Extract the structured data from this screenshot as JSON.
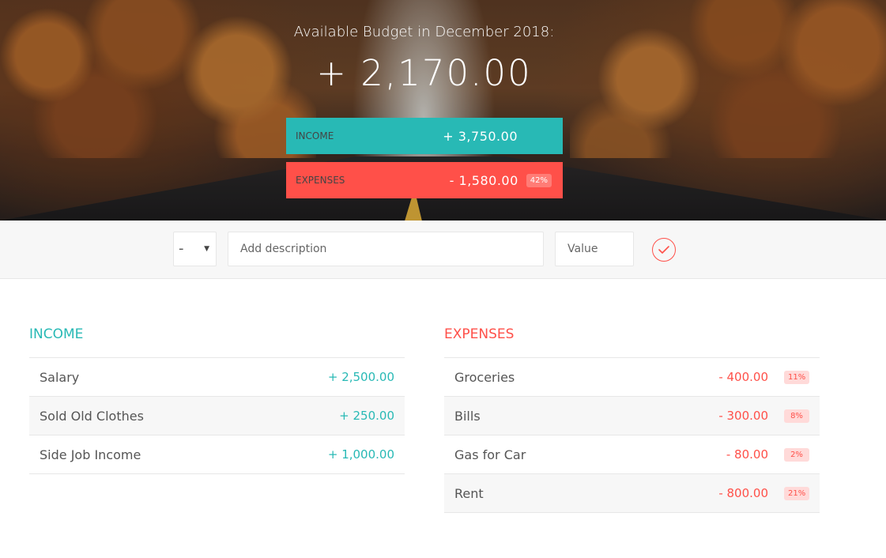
{
  "budget": {
    "title": "Available Budget in December 2018:",
    "value": "+ 2,170.00",
    "income_label": "Income",
    "income_value": "+ 3,750.00",
    "expenses_label": "Expenses",
    "expenses_value": "- 1,580.00",
    "expenses_percent": "42%"
  },
  "add": {
    "type_value": "-",
    "description_placeholder": "Add description",
    "value_placeholder": "Value"
  },
  "income": {
    "title": "Income",
    "items": [
      {
        "description": "Salary",
        "value": "+ 2,500.00"
      },
      {
        "description": "Sold Old Clothes",
        "value": "+ 250.00"
      },
      {
        "description": "Side Job Income",
        "value": "+ 1,000.00"
      }
    ]
  },
  "expenses": {
    "title": "Expenses",
    "items": [
      {
        "description": "Groceries",
        "value": "- 400.00",
        "percent": "11%"
      },
      {
        "description": "Bills",
        "value": "- 300.00",
        "percent": "8%"
      },
      {
        "description": "Gas for Car",
        "value": "- 80.00",
        "percent": "2%"
      },
      {
        "description": "Rent",
        "value": "- 800.00",
        "percent": "21%"
      }
    ]
  },
  "colors": {
    "income": "#28b9b5",
    "expenses": "#ff5049"
  },
  "icons": {
    "add": "checkmark-circle-icon",
    "type_caret": "caret-down-icon"
  }
}
